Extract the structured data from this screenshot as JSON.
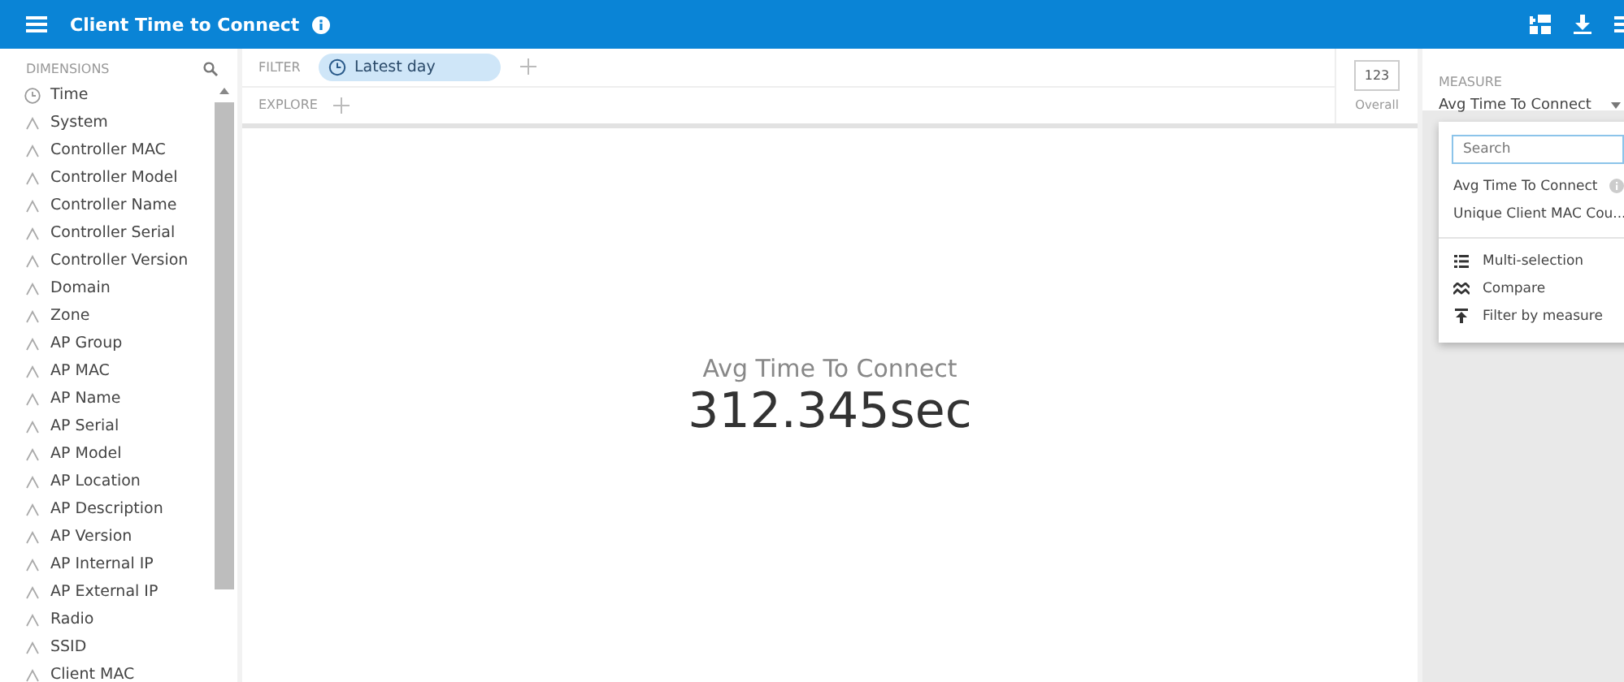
{
  "header": {
    "title": "Client Time to Connect"
  },
  "dimensions": {
    "title": "DIMENSIONS",
    "items": [
      {
        "kind": "time",
        "label": "Time"
      },
      {
        "kind": "string",
        "label": "System"
      },
      {
        "kind": "string",
        "label": "Controller MAC"
      },
      {
        "kind": "string",
        "label": "Controller Model"
      },
      {
        "kind": "string",
        "label": "Controller Name"
      },
      {
        "kind": "string",
        "label": "Controller Serial"
      },
      {
        "kind": "string",
        "label": "Controller Version"
      },
      {
        "kind": "string",
        "label": "Domain"
      },
      {
        "kind": "string",
        "label": "Zone"
      },
      {
        "kind": "string",
        "label": "AP Group"
      },
      {
        "kind": "string",
        "label": "AP MAC"
      },
      {
        "kind": "string",
        "label": "AP Name"
      },
      {
        "kind": "string",
        "label": "AP Serial"
      },
      {
        "kind": "string",
        "label": "AP Model"
      },
      {
        "kind": "string",
        "label": "AP Location"
      },
      {
        "kind": "string",
        "label": "AP Description"
      },
      {
        "kind": "string",
        "label": "AP Version"
      },
      {
        "kind": "string",
        "label": "AP Internal IP"
      },
      {
        "kind": "string",
        "label": "AP External IP"
      },
      {
        "kind": "string",
        "label": "Radio"
      },
      {
        "kind": "string",
        "label": "SSID"
      },
      {
        "kind": "string",
        "label": "Client MAC"
      }
    ]
  },
  "filter": {
    "label": "FILTER",
    "chips": [
      {
        "label": "Latest day"
      }
    ]
  },
  "explore": {
    "label": "EXPLORE"
  },
  "viz": {
    "icon_text": "123",
    "caption": "Overall"
  },
  "metric": {
    "title": "Avg Time To Connect",
    "value": "312.345sec"
  },
  "measure": {
    "label": "MEASURE",
    "selected_value": "Avg Time To Connect",
    "dropdown": {
      "placeholder": "Search",
      "options": [
        {
          "label": "Avg Time To Connect"
        },
        {
          "label": "Unique Client MAC Cou..."
        }
      ],
      "actions": [
        {
          "kind": "list",
          "label": "Multi-selection"
        },
        {
          "kind": "compare",
          "label": "Compare"
        },
        {
          "kind": "filter",
          "label": "Filter by measure"
        }
      ]
    }
  }
}
